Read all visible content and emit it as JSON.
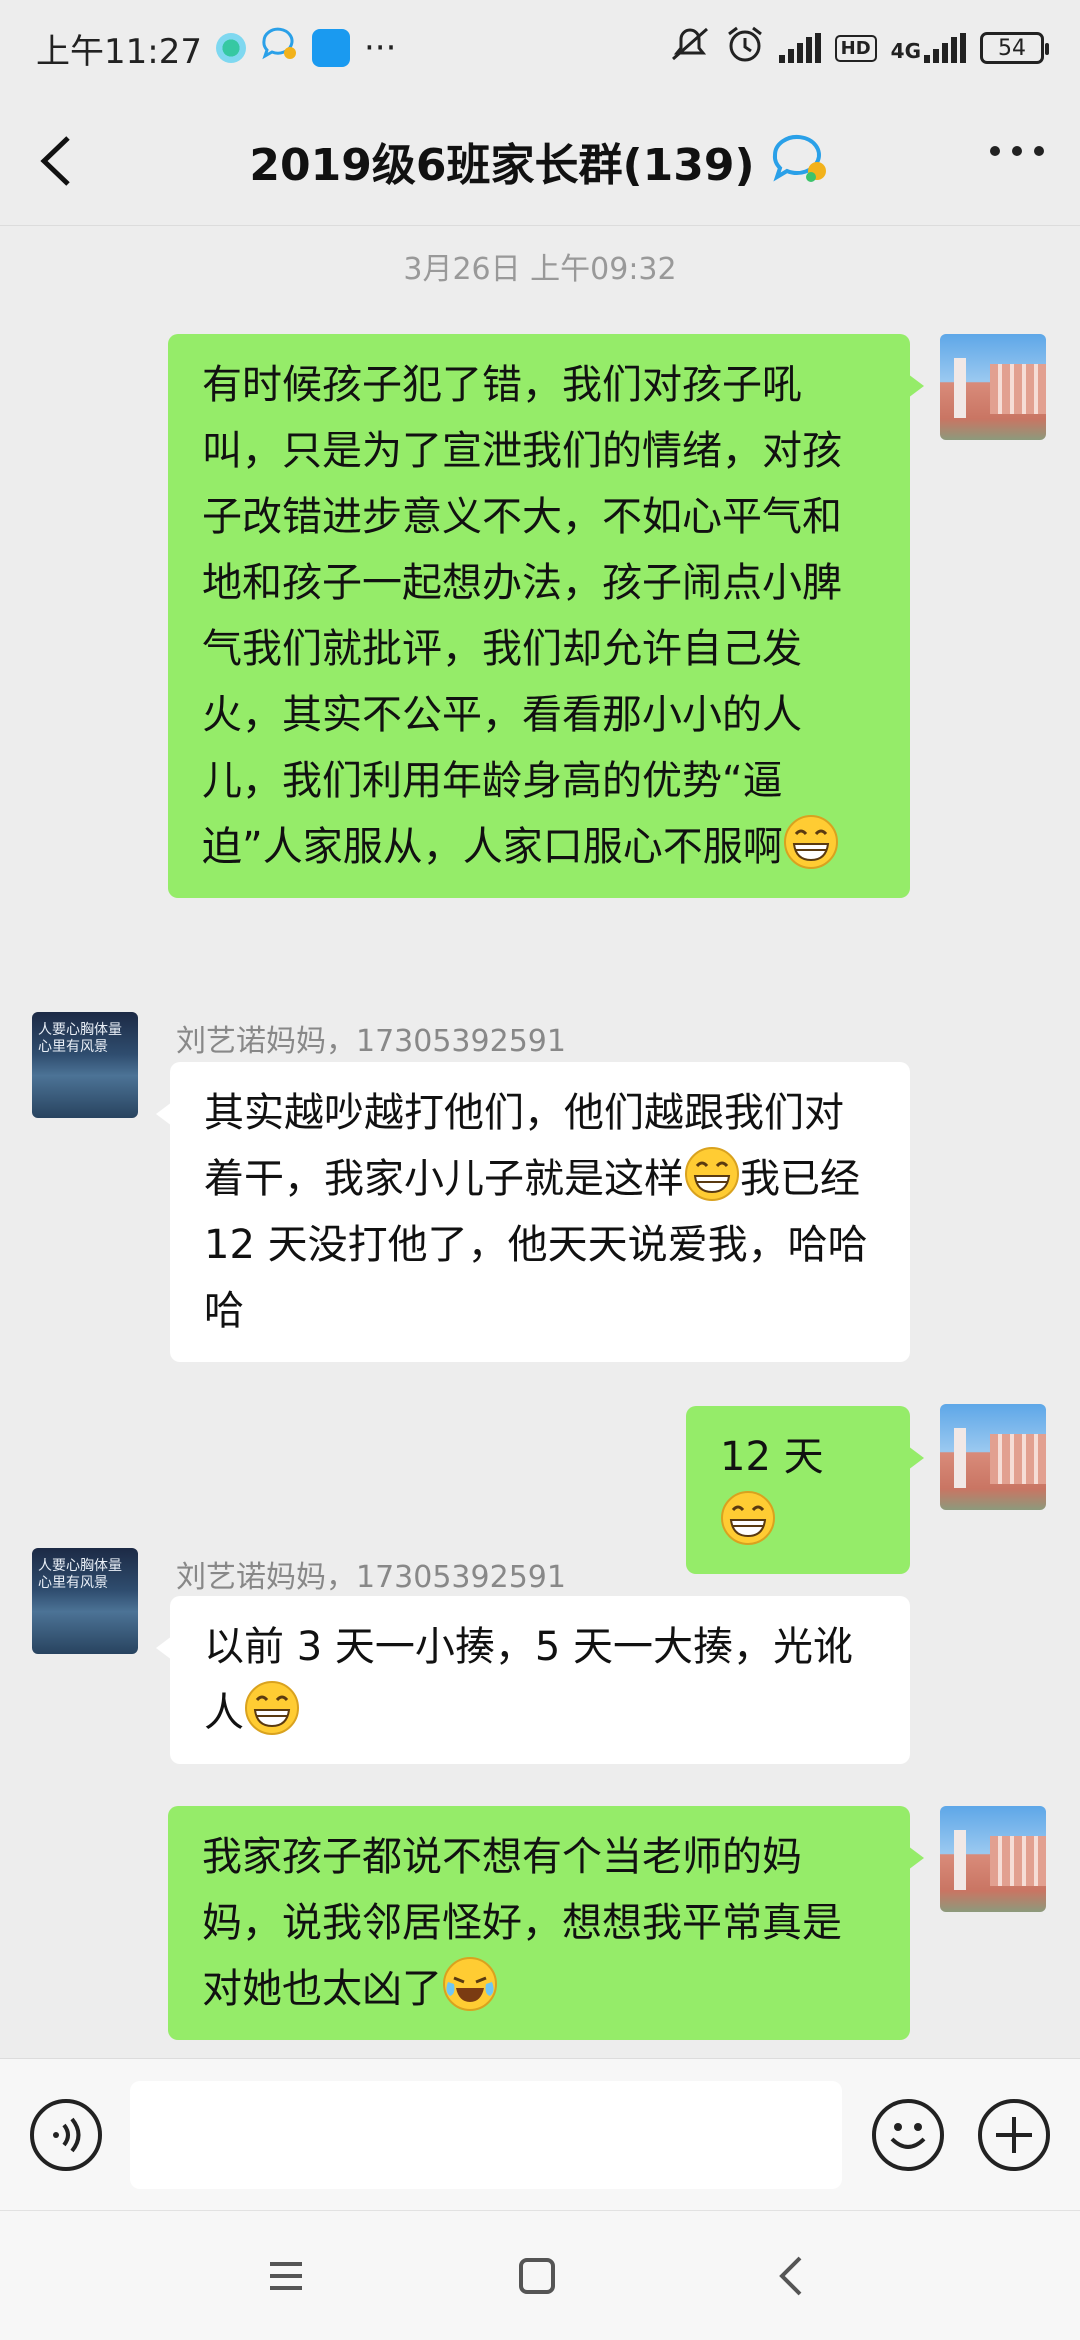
{
  "status_bar": {
    "time": "上午11:27",
    "more": "···",
    "network": "4G",
    "hd": "HD",
    "battery": "54"
  },
  "header": {
    "title": "2019级6班家长群(139)"
  },
  "timestamp": "3月26日 上午09:32",
  "messages": [
    {
      "sender": "",
      "text": "有时候孩子犯了错，我们对孩子吼叫，只是为了宣泄我们的情绪，对孩子改错进步意义不大，不如心平气和地和孩子一起想办法，孩子闹点小脾气我们就批评，我们却允许自己发火，其实不公平，看看那小小的人儿，我们利用年龄身高的优势“逼迫”人家服从，人家口服心不服啊",
      "emoji": "grin"
    },
    {
      "sender": "刘艺诺妈妈，17305392591",
      "text_a": "其实越吵越打他们，他们越跟我们对着干，我家小儿子就是这样",
      "text_b": "我已经 12 天没打他了，他天天说爱我，哈哈哈",
      "emoji": "grin"
    },
    {
      "sender": "",
      "text": "12 天",
      "emoji": "grin"
    },
    {
      "sender": "刘艺诺妈妈，17305392591",
      "text": "以前 3 天一小揍，5 天一大揍，光讹人",
      "emoji": "grin"
    },
    {
      "sender": "",
      "text": "我家孩子都说不想有个当老师的妈妈，说我邻居怪好，想想我平常真是对她也太凶了",
      "emoji": "laugh-cry"
    }
  ],
  "input": {
    "value": "",
    "placeholder": ""
  },
  "colors": {
    "my_bubble": "#95ec69",
    "their_bubble": "#ffffff",
    "background": "#ededed"
  },
  "icons": [
    "voice-icon",
    "emoji-icon",
    "plus-icon",
    "back-icon",
    "more-icon",
    "menu-icon",
    "home-icon",
    "nav-back-icon"
  ]
}
